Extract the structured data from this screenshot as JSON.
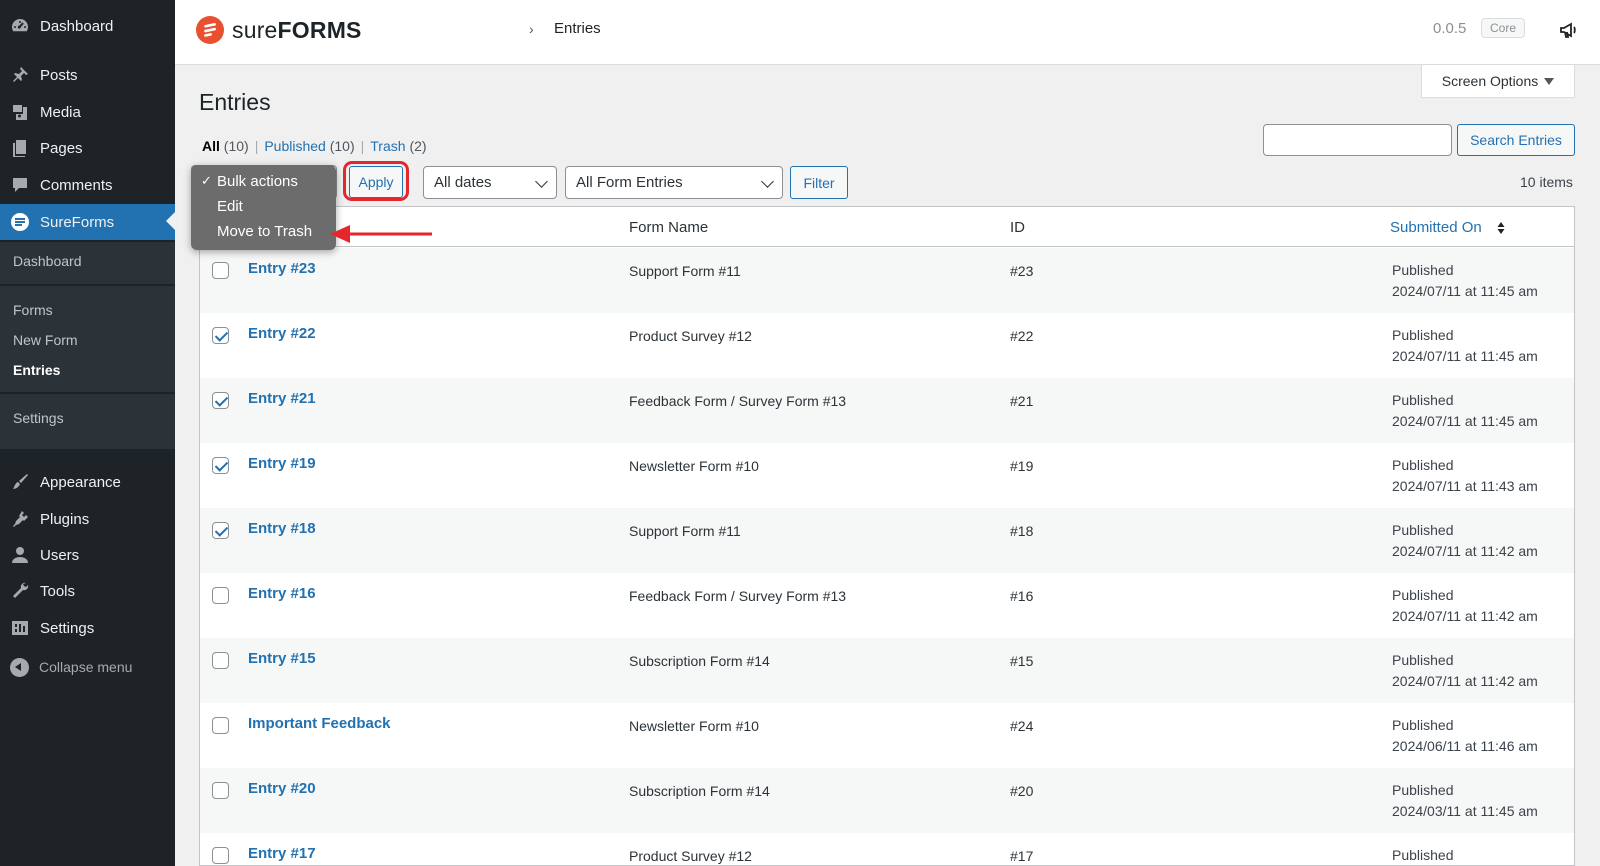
{
  "sidebar": {
    "items": [
      {
        "label": "Dashboard",
        "icon": "dashboard-icon"
      },
      {
        "label": "Posts",
        "icon": "pin-icon"
      },
      {
        "label": "Media",
        "icon": "media-icon"
      },
      {
        "label": "Pages",
        "icon": "pages-icon"
      },
      {
        "label": "Comments",
        "icon": "comment-icon"
      },
      {
        "label": "SureForms",
        "icon": "sureforms-icon"
      },
      {
        "label": "Appearance",
        "icon": "brush-icon"
      },
      {
        "label": "Plugins",
        "icon": "plugin-icon"
      },
      {
        "label": "Users",
        "icon": "user-icon"
      },
      {
        "label": "Tools",
        "icon": "wrench-icon"
      },
      {
        "label": "Settings",
        "icon": "settings-icon"
      }
    ],
    "submenu": [
      "Dashboard",
      "Forms",
      "New Form",
      "Entries",
      "Settings"
    ],
    "collapse_label": "Collapse menu"
  },
  "header": {
    "logo_sure": "sure",
    "logo_forms": "FORMS",
    "breadcrumb_sep": "›",
    "breadcrumb_current": "Entries",
    "version": "0.0.5",
    "badge": "Core"
  },
  "page": {
    "screen_options": "Screen Options",
    "title": "Entries",
    "views": [
      {
        "label": "All",
        "count": "(10)"
      },
      {
        "label": "Published",
        "count": "(10)"
      },
      {
        "label": "Trash",
        "count": "(2)"
      }
    ],
    "search_button": "Search Entries",
    "search_value": "",
    "apply_button": "Apply",
    "dates_select": "All dates",
    "forms_select": "All Form Entries",
    "filter_button": "Filter",
    "items_count": "10 items"
  },
  "bulk_dropdown": {
    "options": [
      "Bulk actions",
      "Edit",
      "Move to Trash"
    ],
    "selected": "Bulk actions",
    "checkmark": "✓"
  },
  "annotation": {
    "highlight_color": "#e5262d"
  },
  "table": {
    "columns": [
      "Form Name",
      "ID",
      "Submitted On"
    ],
    "rows": [
      {
        "entry": "Entry #23",
        "form": "Support Form #11",
        "id": "#23",
        "status": "Published",
        "date": "2024/07/11 at 11:45 am",
        "checked": false
      },
      {
        "entry": "Entry #22",
        "form": "Product Survey #12",
        "id": "#22",
        "status": "Published",
        "date": "2024/07/11 at 11:45 am",
        "checked": true
      },
      {
        "entry": "Entry #21",
        "form": "Feedback Form / Survey Form #13",
        "id": "#21",
        "status": "Published",
        "date": "2024/07/11 at 11:45 am",
        "checked": true
      },
      {
        "entry": "Entry #19",
        "form": "Newsletter Form #10",
        "id": "#19",
        "status": "Published",
        "date": "2024/07/11 at 11:43 am",
        "checked": true
      },
      {
        "entry": "Entry #18",
        "form": "Support Form #11",
        "id": "#18",
        "status": "Published",
        "date": "2024/07/11 at 11:42 am",
        "checked": true
      },
      {
        "entry": "Entry #16",
        "form": "Feedback Form / Survey Form #13",
        "id": "#16",
        "status": "Published",
        "date": "2024/07/11 at 11:42 am",
        "checked": false
      },
      {
        "entry": "Entry #15",
        "form": "Subscription Form #14",
        "id": "#15",
        "status": "Published",
        "date": "2024/07/11 at 11:42 am",
        "checked": false
      },
      {
        "entry": "Important Feedback",
        "form": "Newsletter Form #10",
        "id": "#24",
        "status": "Published",
        "date": "2024/06/11 at 11:46 am",
        "checked": false
      },
      {
        "entry": "Entry #20",
        "form": "Subscription Form #14",
        "id": "#20",
        "status": "Published",
        "date": "2024/03/11 at 11:45 am",
        "checked": false
      },
      {
        "entry": "Entry #17",
        "form": "Product Survey #12",
        "id": "#17",
        "status": "Published",
        "date": "",
        "checked": false
      }
    ]
  },
  "colors": {
    "sidebar_bg": "#1d2327",
    "accent": "#2271b1",
    "brand": "#e8502f"
  }
}
